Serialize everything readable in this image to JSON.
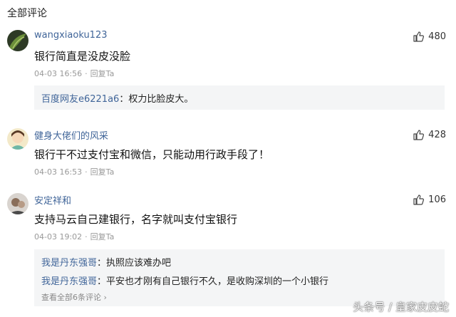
{
  "section_title": "全部评论",
  "comments": [
    {
      "username": "wangxiaoku123",
      "likes": "480",
      "content": "银行简直是没皮没脸",
      "time": "04-03 16:56",
      "reply_label": "回复Ta",
      "replies": [
        {
          "who": "百度网友e6221a6",
          "sep": "：",
          "text": "权力比脸皮大。"
        }
      ]
    },
    {
      "username": "健身大佬们的风采",
      "likes": "428",
      "content": "银行干不过支付宝和微信，只能动用行政手段了！",
      "time": "04-03 16:53",
      "reply_label": "回复Ta",
      "replies": []
    },
    {
      "username": "安定祥和",
      "likes": "106",
      "content": "支持马云自己建银行，名字就叫支付宝银行",
      "time": "04-03 19:02",
      "reply_label": "回复Ta",
      "replies": [
        {
          "who": "我是丹东强哥",
          "sep": "：",
          "text": "执照应该难办吧"
        },
        {
          "who": "我是丹东强哥",
          "sep": "：",
          "text": "平安也才刚有自己银行不久，是收购深圳的一个小银行"
        }
      ],
      "view_all": "查看全部6条评论 ›"
    }
  ],
  "watermark": "头条号 / 皇家皮皮蛇"
}
